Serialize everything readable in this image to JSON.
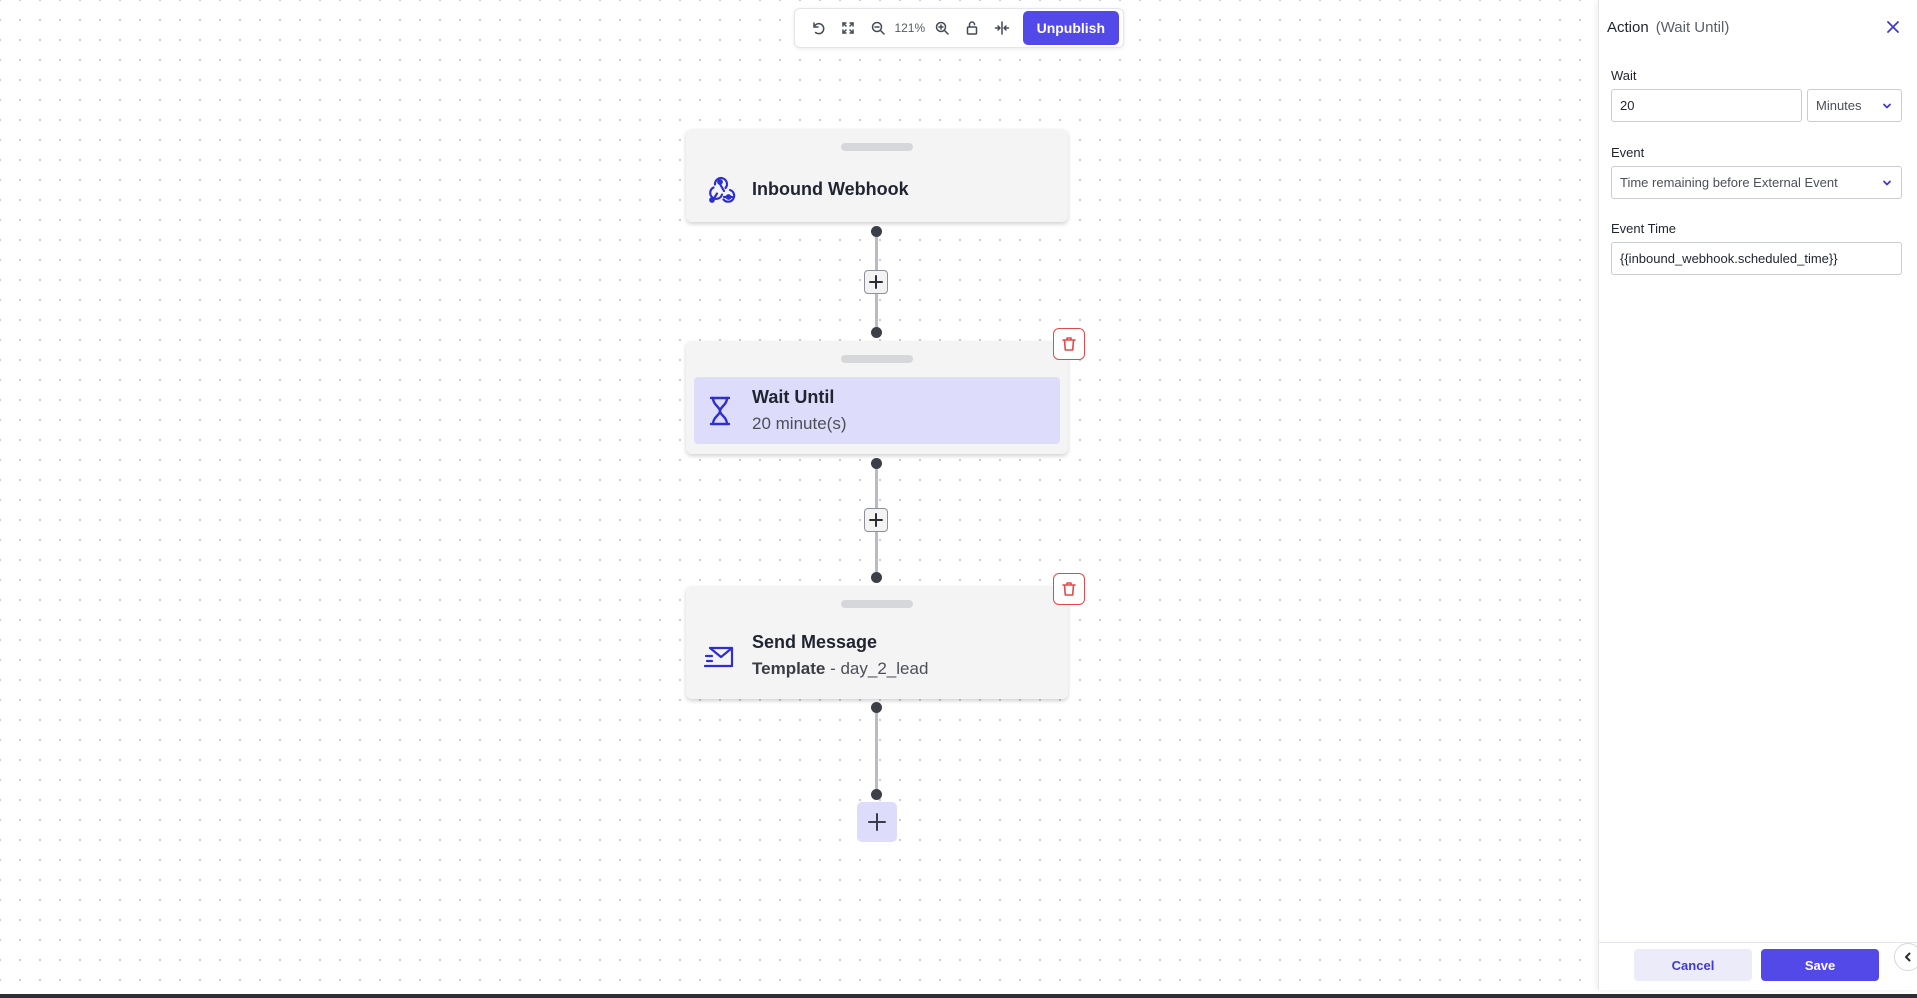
{
  "toolbar": {
    "zoom_level": "121%",
    "unpublish_label": "Unpublish"
  },
  "flow": {
    "nodes": [
      {
        "title": "Inbound Webhook",
        "icon": "webhook-icon"
      },
      {
        "title": "Wait Until",
        "subtitle": "20 minute(s)",
        "icon": "hourglass-icon",
        "selected": true
      },
      {
        "title": "Send Message",
        "subtitle_bold": "Template",
        "subtitle_rest": " - day_2_lead",
        "icon": "send-message-icon"
      }
    ]
  },
  "panel": {
    "title": "Action",
    "subtitle": "(Wait Until)",
    "wait_label": "Wait",
    "wait_value": "20",
    "wait_unit": "Minutes",
    "event_label": "Event",
    "event_value": "Time remaining before External Event",
    "event_time_label": "Event Time",
    "event_time_value": "{{inbound_webhook.scheduled_time}}",
    "cancel_label": "Cancel",
    "save_label": "Save"
  },
  "colors": {
    "accent": "#5348e8",
    "selected_node": "#dedcfb",
    "danger": "#e04a4a",
    "icon_blue": "#2f2fd0"
  }
}
